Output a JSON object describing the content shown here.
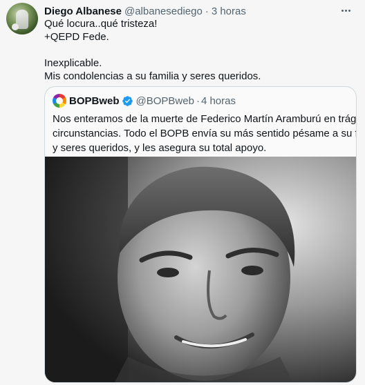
{
  "tweet": {
    "author_name": "Diego Albanese",
    "author_handle": "@albanesediego",
    "separator": "·",
    "time": "3 horas",
    "lines": [
      "Qué locura..qué tristeza!",
      "+QEPD Fede.",
      "",
      "Inexplicable.",
      "Mis condolencias a su familia y seres queridos."
    ]
  },
  "quoted": {
    "author_name": "BOPBweb",
    "author_handle": "@BOPBweb",
    "separator": "·",
    "time": "4 horas",
    "lines": [
      "Nos enteramos de la muerte de Federico Martín Aramburú en trágicas",
      "circunstancias. Todo el BOPB envía su más sentido pésame a su familia",
      "y seres queridos, y les asegura su total apoyo."
    ]
  },
  "icons": {
    "more": "more-options-icon",
    "verified": "verified-badge-icon"
  },
  "colors": {
    "text_primary": "#0f1419",
    "text_secondary": "#536471",
    "verified_blue": "#1d9bf0",
    "border": "#cfd9de"
  }
}
